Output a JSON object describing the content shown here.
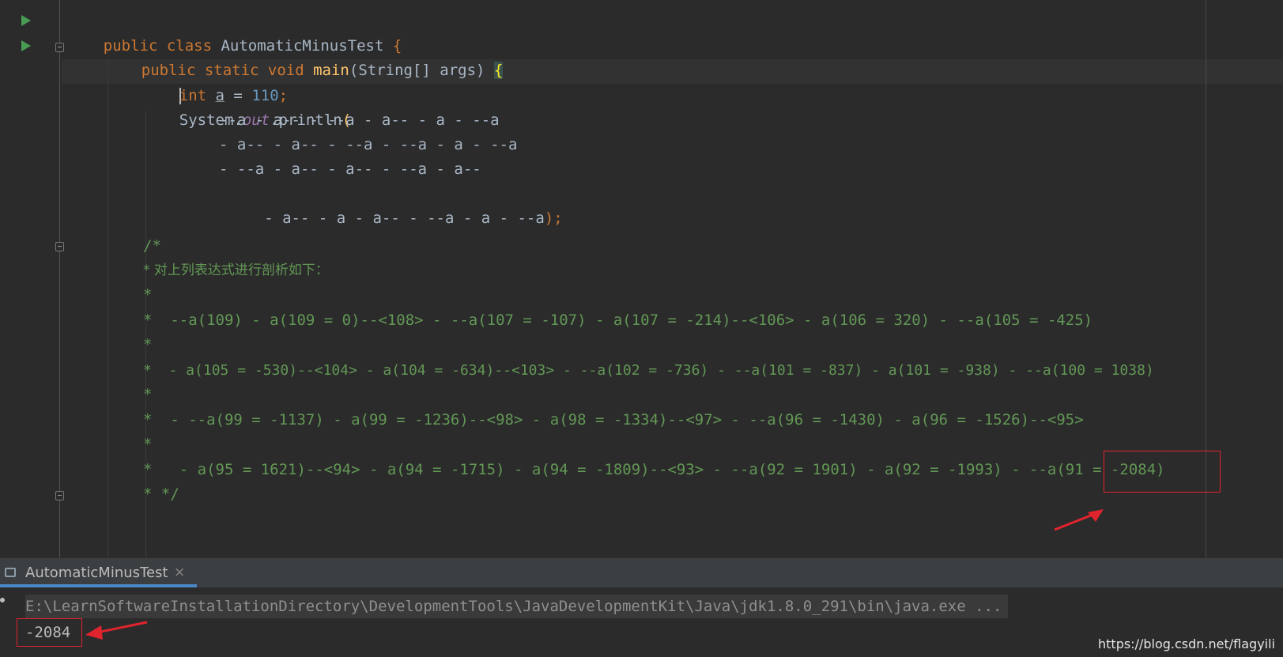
{
  "editor": {
    "class_line": {
      "kw": "public class ",
      "name": "AutomaticMinusTest",
      "brace": " {"
    },
    "main_line": {
      "kw": "public static void ",
      "fn": "main",
      "params": "(String[] args) ",
      "brace": "{"
    },
    "decl_line": {
      "kw": "int ",
      "var": "a",
      "eq": " = ",
      "num": "110",
      "semi": ";"
    },
    "println_line": {
      "obj": "System.",
      "field": "out",
      "method": ".println",
      "paren": "("
    },
    "expr_lines": [
      "--a - a-- - --a - a-- - a - --a",
      "- a-- - a-- - --a - --a - a - --a",
      "- --a - a-- - a-- - --a - a--",
      " - a-- - a - a-- - --a - a - --a"
    ],
    "expr_end": ");",
    "comment_lines": [
      "/*",
      "* 对上列表达式进行剖析如下：",
      "*",
      "*  --a(109) - a(109 = 0)--<108> - --a(107 = -107) - a(107 = -214)--<106> - a(106 = 320) - --a(105 = -425)",
      "*",
      "*  - a(105 = -530)--<104> - a(104 = -634)--<103> - --a(102 = -736) - --a(101 = -837) - a(101 = -938) - --a(100 = 1038)",
      "*",
      "*  - --a(99 = -1137) - a(99 = -1236)--<98> - a(98 = -1334)--<97> - --a(96 = -1430) - a(96 = -1526)--<95>",
      "*",
      "*   - a(95 = 1621)--<94> - a(94 = -1715) - a(94 = -1809)--<93> - --a(92 = 1901) - a(92 = -1993) - --a(91 = -2084)",
      "* */"
    ]
  },
  "run_panel": {
    "tab_label": "AutomaticMinusTest",
    "tab_close": "×",
    "command": "E:\\LearnSoftwareInstallationDirectory\\DevelopmentTools\\JavaDevelopmentKit\\Java\\jdk1.8.0_291\\bin\\java.exe ...",
    "output": "-2084"
  },
  "watermark": "https://blog.csdn.net/flagyili",
  "colors": {
    "background": "#2b2b2b",
    "keyword": "#cc7832",
    "function": "#ffc66d",
    "number": "#6897bb",
    "comment": "#629755",
    "annotation": "#e0242e"
  }
}
